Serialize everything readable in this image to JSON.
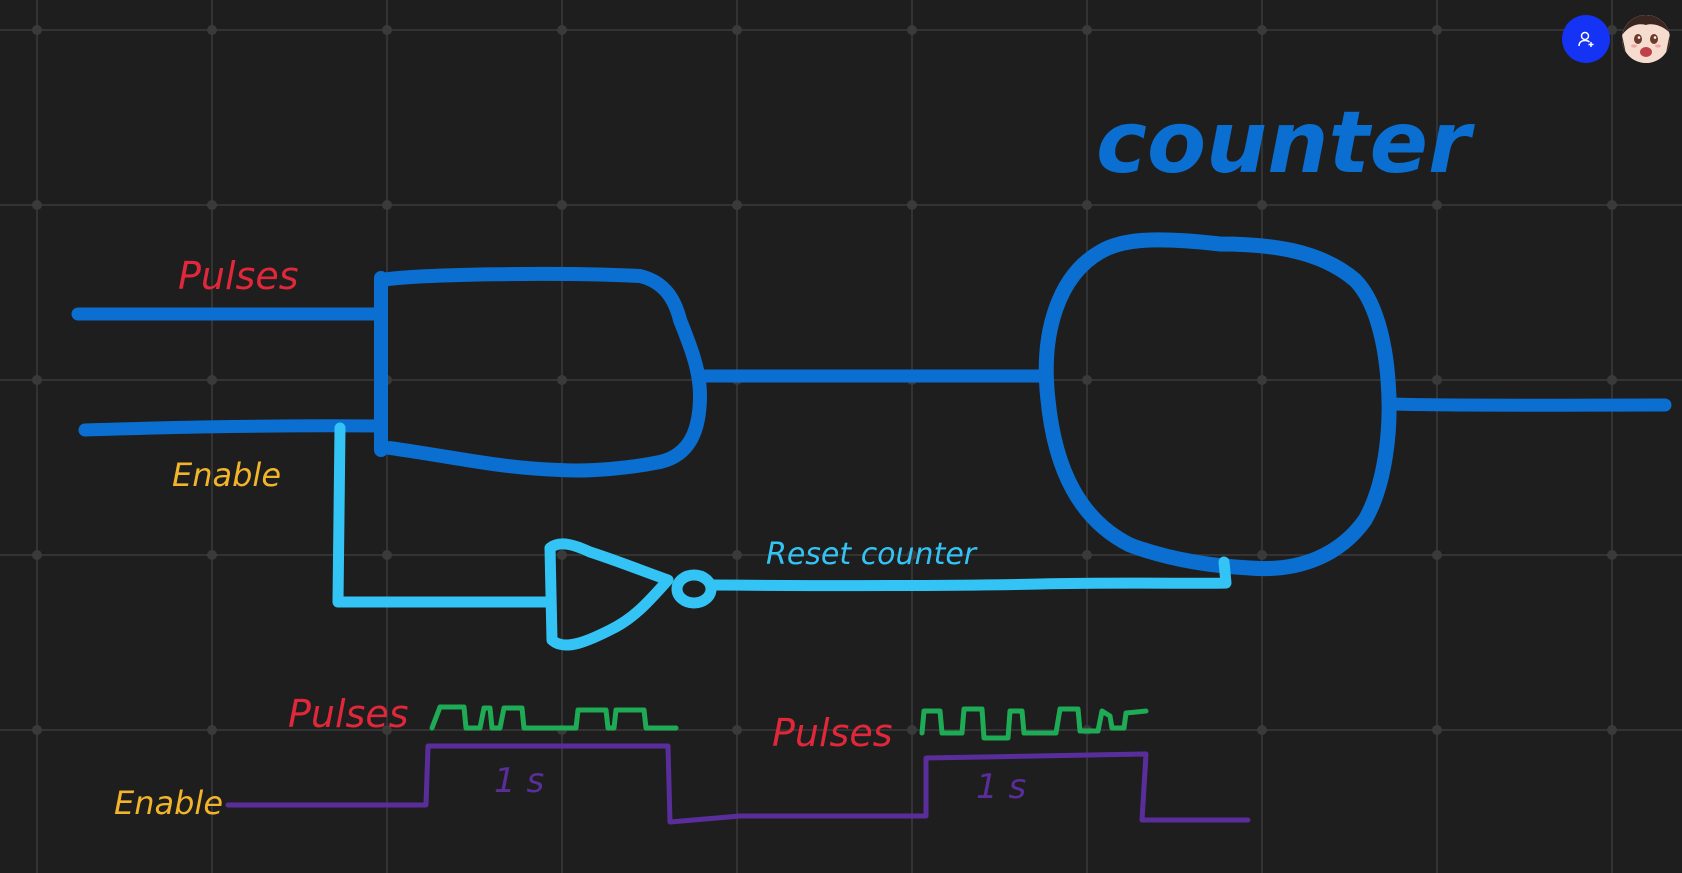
{
  "colors": {
    "background": "#1e1e1e",
    "grid": "#333333",
    "gate_blue": "#0a6fd1",
    "wire_light_blue": "#33c4f5",
    "label_red": "#e0283a",
    "label_yellow": "#f2b42a",
    "pulse_green": "#1faa55",
    "enable_purple": "#5a2e9a",
    "invite_button": "#1433f5"
  },
  "labels": {
    "counter": "counter",
    "pulses_top": "Pulses",
    "enable_top": "Enable",
    "reset_counter": "Reset counter",
    "pulses_timing_1": "Pulses",
    "pulses_timing_2": "Pulses",
    "enable_timing": "Enable",
    "duration_1": "1 s",
    "duration_2": "1 s"
  },
  "toolbar": {
    "invite_icon": "add-user-icon",
    "avatar_icon": "user-avatar"
  }
}
